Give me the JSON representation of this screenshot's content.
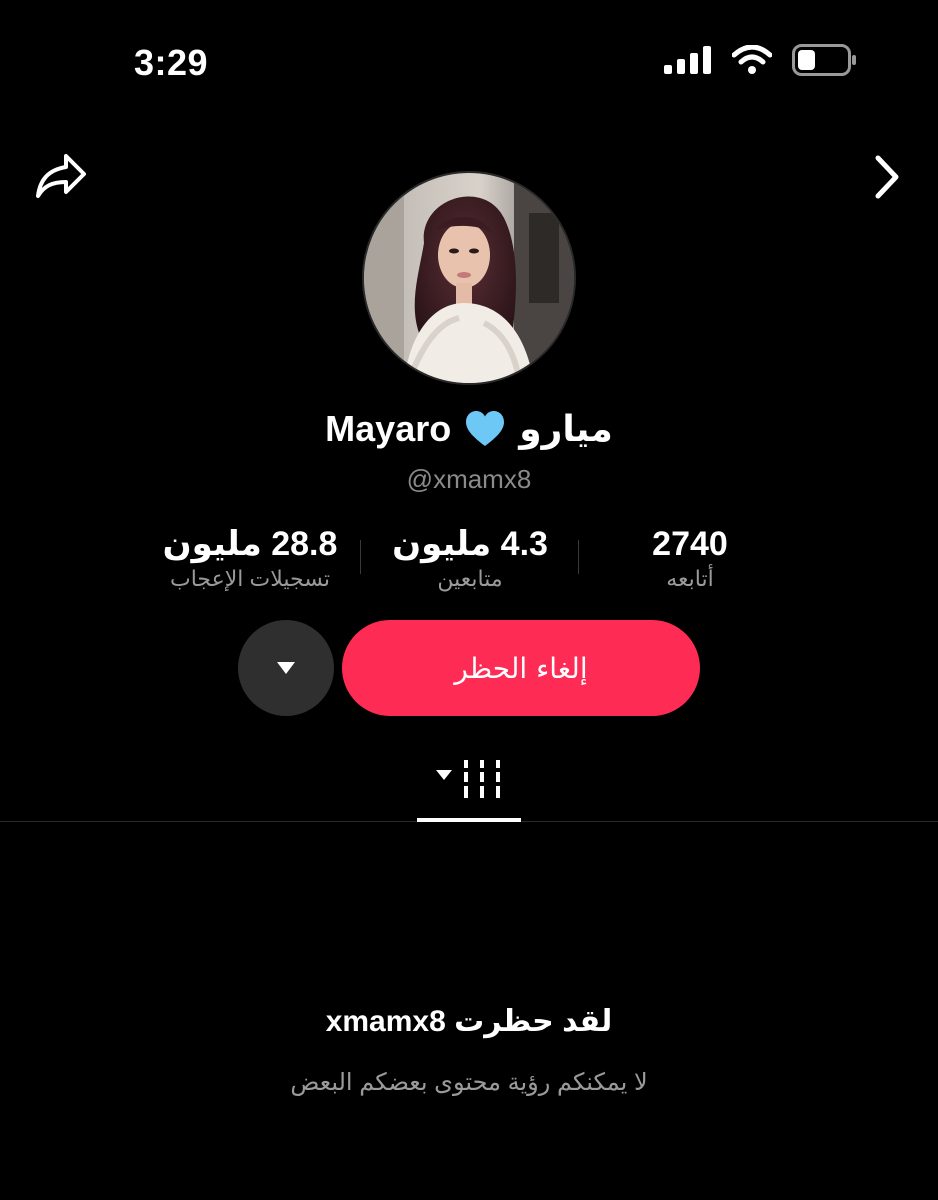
{
  "status_bar": {
    "time": "3:29",
    "icons": [
      "cellular-signal-icon",
      "wifi-icon",
      "battery-icon"
    ]
  },
  "nav": {
    "share_icon": "share-icon",
    "next_icon": "chevron-right-icon"
  },
  "profile": {
    "display_name": "Mayaro 🩵 ميارو",
    "name_part_latin": "Mayaro",
    "name_part_arabic": "ميارو",
    "heart_icon": "blue-heart-icon",
    "username": "@xmamx8"
  },
  "stats": {
    "likes": {
      "value": "28.8 مليون",
      "label": "تسجيلات الإعجاب"
    },
    "followers": {
      "value": "4.3 مليون",
      "label": "متابعين"
    },
    "following": {
      "value": "2740",
      "label": "أتابعه"
    }
  },
  "actions": {
    "unblock_label": "إلغاء الحظر",
    "more_icon": "caret-down-icon"
  },
  "tabs": {
    "videos_icon": "grid-filter-icon"
  },
  "blocked_message": {
    "title": "لقد حظرت xmamx8",
    "subtitle": "لا يمكنكم رؤية محتوى بعضكم البعض"
  },
  "colors": {
    "background": "#000000",
    "accent": "#fe2c55",
    "secondary_text": "#8a8a8a",
    "heart": "#6ec8f5"
  }
}
